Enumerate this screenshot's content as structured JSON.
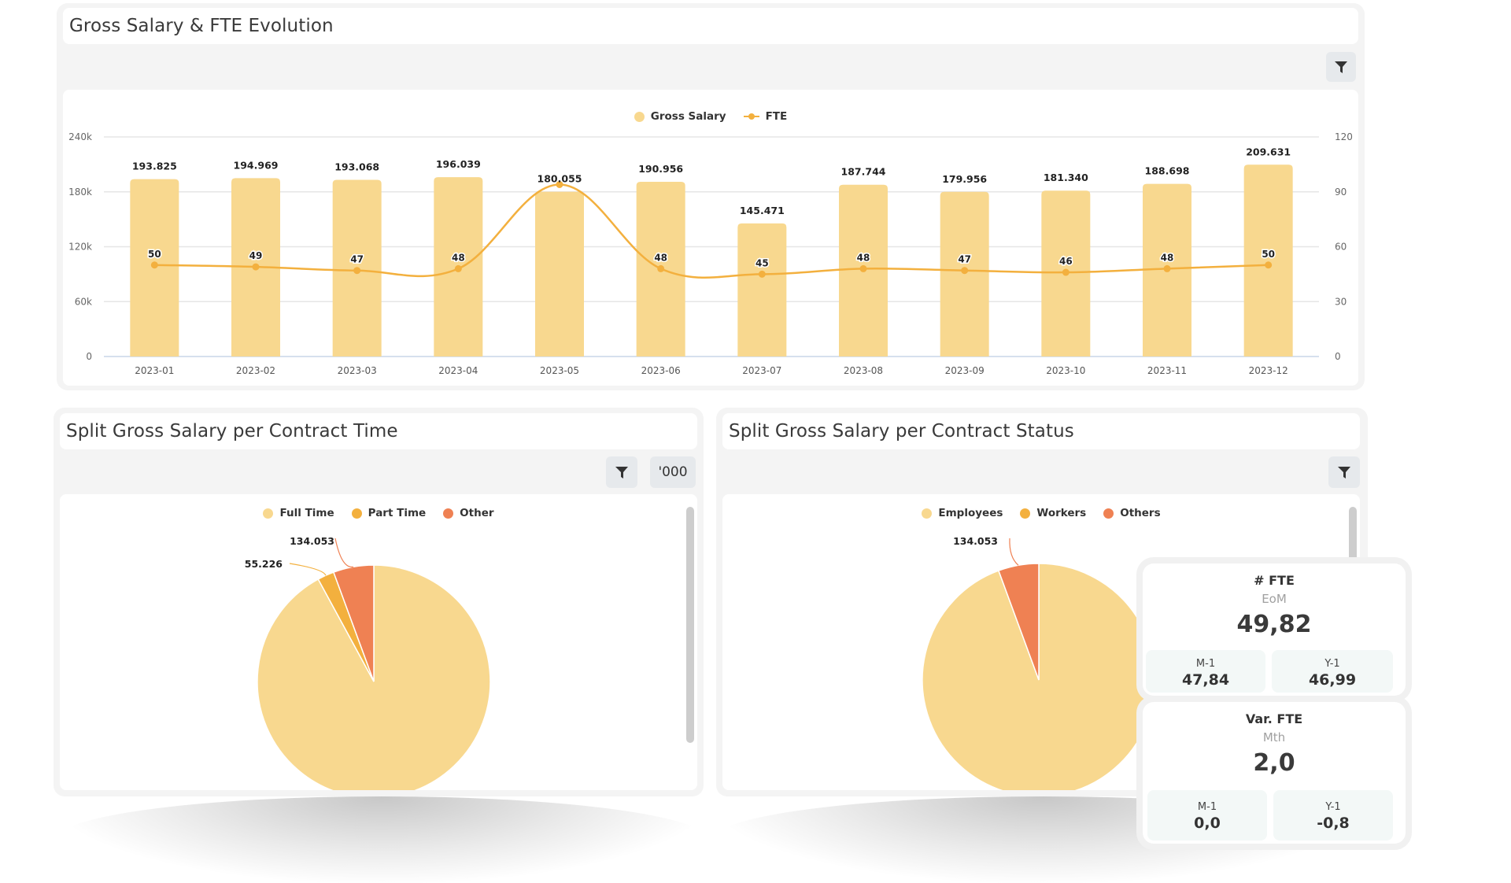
{
  "top_chart": {
    "title": "Gross Salary & FTE Evolution",
    "filter_icon": "filter-icon",
    "legend": [
      {
        "label": "Gross Salary",
        "color": "#f8d88f",
        "marker": "dot"
      },
      {
        "label": "FTE",
        "color": "#f3b03e",
        "marker": "line-dot"
      }
    ]
  },
  "contract_time": {
    "title": "Split Gross Salary per Contract Time",
    "filter_icon": "filter-icon",
    "unit_button": "'000",
    "legend": [
      {
        "label": "Full Time",
        "color": "#f8d88f"
      },
      {
        "label": "Part Time",
        "color": "#f3b03e"
      },
      {
        "label": "Other",
        "color": "#ef8153"
      }
    ]
  },
  "contract_status": {
    "title": "Split Gross Salary per Contract Status",
    "filter_icon": "filter-icon",
    "legend": [
      {
        "label": "Employees",
        "color": "#f8d88f"
      },
      {
        "label": "Workers",
        "color": "#f3b03e"
      },
      {
        "label": "Others",
        "color": "#ef8153"
      }
    ]
  },
  "kpi_fte": {
    "title": "# FTE",
    "subtitle": "EoM",
    "value": "49,82",
    "m1_label": "M-1",
    "m1_value": "47,84",
    "y1_label": "Y-1",
    "y1_value": "46,99"
  },
  "kpi_var_fte": {
    "title": "Var. FTE",
    "subtitle": "Mth",
    "value": "2,0",
    "m1_label": "M-1",
    "m1_value": "0,0",
    "y1_label": "Y-1",
    "y1_value": "-0,8"
  },
  "chart_data": [
    {
      "type": "bar",
      "title": "Gross Salary & FTE Evolution",
      "categories": [
        "2023-01",
        "2023-02",
        "2023-03",
        "2023-04",
        "2023-05",
        "2023-06",
        "2023-07",
        "2023-08",
        "2023-09",
        "2023-10",
        "2023-11",
        "2023-12"
      ],
      "series": [
        {
          "name": "Gross Salary",
          "type": "bar",
          "axis": "left",
          "color": "#f8d88f",
          "values": [
            193825,
            194969,
            193068,
            196039,
            180055,
            190956,
            145471,
            187744,
            179956,
            181340,
            188698,
            209631
          ],
          "labels": [
            "193.825",
            "194.969",
            "193.068",
            "196.039",
            "180.055",
            "190.956",
            "145.471",
            "187.744",
            "179.956",
            "181.340",
            "188.698",
            "209.631"
          ]
        },
        {
          "name": "FTE",
          "type": "line",
          "smooth": true,
          "axis": "right",
          "color": "#f3b03e",
          "values": [
            50,
            49,
            47,
            48,
            94,
            48,
            45,
            48,
            47,
            46,
            48,
            50
          ],
          "labels": [
            "50",
            "49",
            "47",
            "48",
            "",
            "48",
            "45",
            "48",
            "47",
            "46",
            "48",
            "50"
          ]
        }
      ],
      "ylim_left": [
        0,
        240000
      ],
      "yticks_left": [
        "0",
        "60k",
        "120k",
        "180k",
        "240k"
      ],
      "ylim_right": [
        0,
        120
      ],
      "yticks_right": [
        "0",
        "30",
        "60",
        "90",
        "120"
      ],
      "grid": true,
      "legend_position": "top-center"
    },
    {
      "type": "pie",
      "title": "Split Gross Salary per Contract Time",
      "unit": "'000",
      "slices": [
        {
          "name": "Full Time",
          "value": 2200,
          "label": "",
          "color": "#f8d88f"
        },
        {
          "name": "Part Time",
          "value": 55.226,
          "label": "55.226",
          "color": "#f3b03e"
        },
        {
          "name": "Other",
          "value": 134.053,
          "label": "134.053",
          "color": "#ef8153"
        }
      ],
      "legend_position": "top-center"
    },
    {
      "type": "pie",
      "title": "Split Gross Salary per Contract Status",
      "slices": [
        {
          "name": "Employees",
          "value": 2255,
          "label": "",
          "color": "#f8d88f"
        },
        {
          "name": "Workers",
          "value": 0,
          "label": "",
          "color": "#f3b03e"
        },
        {
          "name": "Others",
          "value": 134.053,
          "label": "134.053",
          "color": "#ef8153"
        }
      ],
      "legend_position": "top-center"
    }
  ]
}
